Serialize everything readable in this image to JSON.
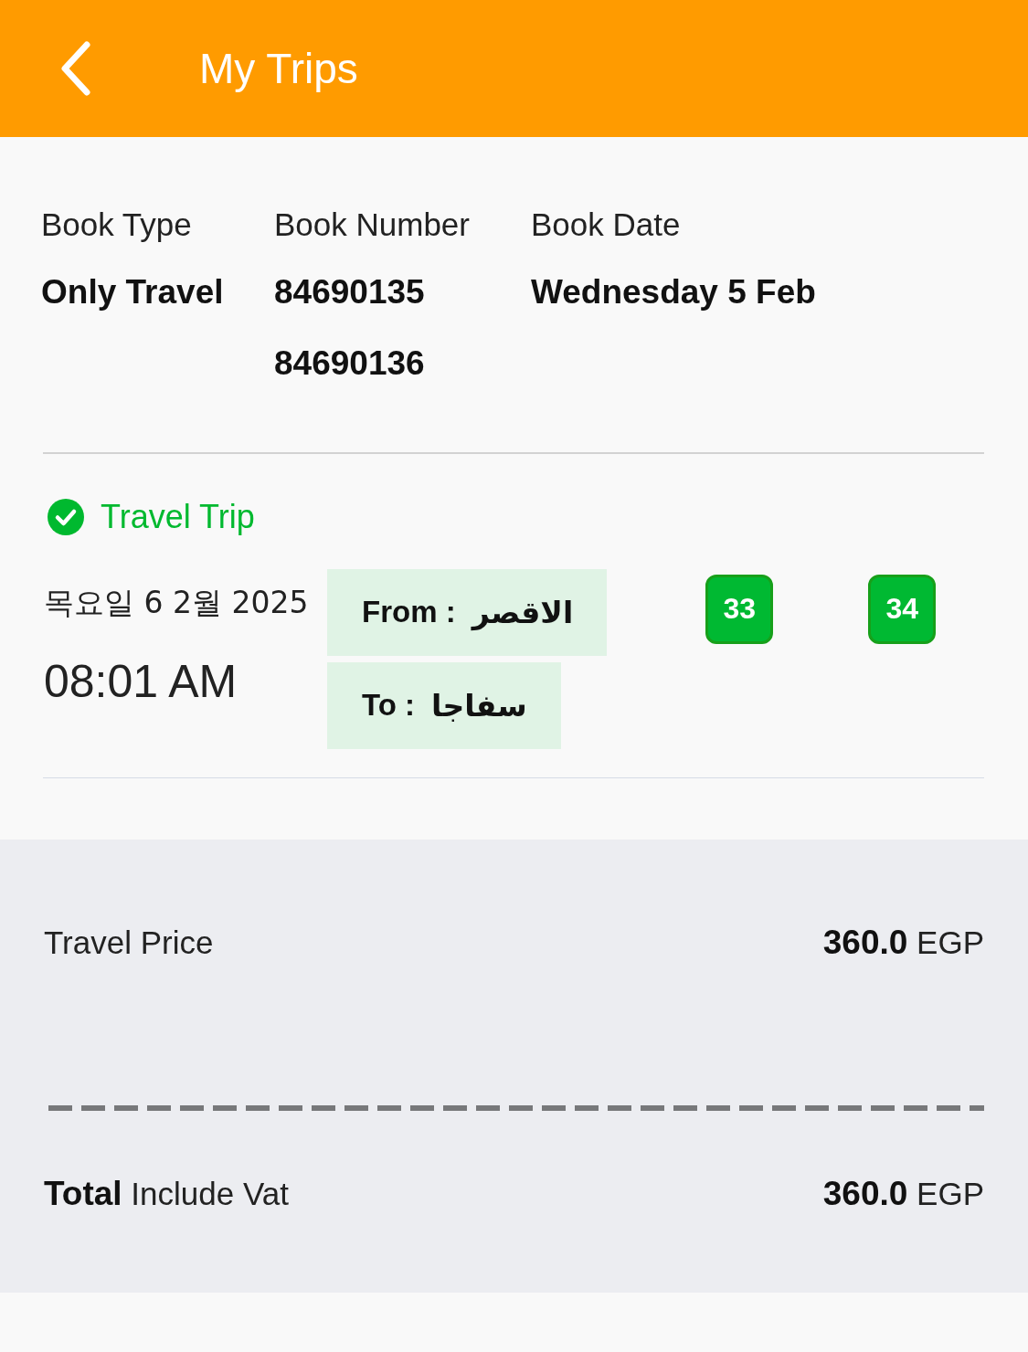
{
  "header": {
    "title": "My Trips"
  },
  "booking": {
    "columns": [
      {
        "label": "Book Type",
        "values": [
          "Only Travel"
        ]
      },
      {
        "label": "Book Number",
        "values": [
          "84690135",
          "84690136"
        ]
      },
      {
        "label": "Book Date",
        "values": [
          "Wednesday 5 Feb"
        ]
      }
    ]
  },
  "trip": {
    "status": "Travel Trip",
    "date": "목요일 6 2월 2025",
    "time": "08:01 AM",
    "route": [
      {
        "label": "From :",
        "place": "الاقصر"
      },
      {
        "label": "To :",
        "place": "سفاجا"
      }
    ],
    "seats": [
      "33",
      "34"
    ]
  },
  "price": {
    "rows": [
      {
        "label": "Travel Price",
        "amount": "**360.0** EGP"
      }
    ],
    "total": {
      "label": "**Total** Include Vat",
      "amount": "**360.0** EGP"
    }
  }
}
